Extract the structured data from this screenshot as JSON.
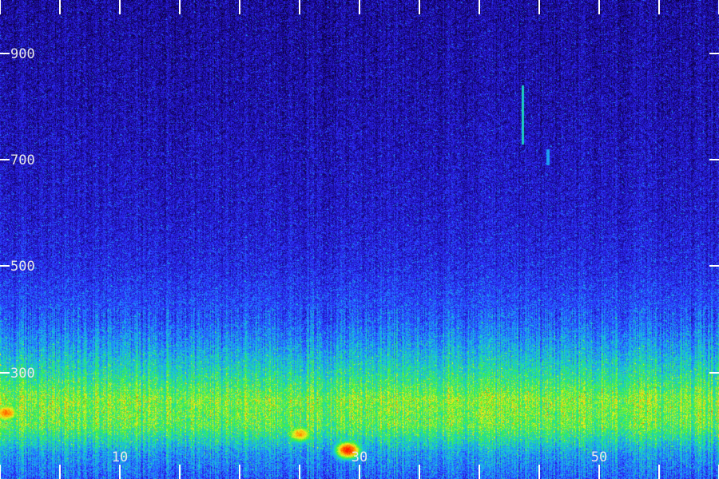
{
  "chart_data": {
    "type": "heatmap",
    "title": "",
    "xlabel": "",
    "ylabel": "",
    "colormap": [
      "#0a0028",
      "#1b0aa0",
      "#2f2cff",
      "#1e90ff",
      "#19d6c8",
      "#3cf03c",
      "#f0f020",
      "#ff8c00",
      "#ff1a00"
    ],
    "xlim": [
      0,
      60
    ],
    "ylim": [
      100,
      1000
    ],
    "y_ticks": [
      {
        "value": 300,
        "label": "300"
      },
      {
        "value": 500,
        "label": "500"
      },
      {
        "value": 700,
        "label": "700"
      },
      {
        "value": 900,
        "label": "900"
      }
    ],
    "x_ticks": [
      {
        "value": 10,
        "label": "10"
      },
      {
        "value": 30,
        "label": "30"
      },
      {
        "value": 50,
        "label": "50"
      }
    ],
    "x_minor_ticks": [
      0,
      5,
      10,
      15,
      20,
      25,
      30,
      35,
      40,
      45,
      50,
      55,
      60
    ],
    "intensity_profile": [
      {
        "freq": 1000,
        "level": 0.12
      },
      {
        "freq": 800,
        "level": 0.14
      },
      {
        "freq": 600,
        "level": 0.18
      },
      {
        "freq": 500,
        "level": 0.22
      },
      {
        "freq": 400,
        "level": 0.3
      },
      {
        "freq": 350,
        "level": 0.4
      },
      {
        "freq": 300,
        "level": 0.52
      },
      {
        "freq": 250,
        "level": 0.66
      },
      {
        "freq": 200,
        "level": 0.62
      },
      {
        "freq": 150,
        "level": 0.4
      },
      {
        "freq": 100,
        "level": 0.3
      }
    ],
    "hotspots": [
      {
        "time": 29,
        "freq": 155,
        "level": 1.0
      },
      {
        "time": 25,
        "freq": 185,
        "level": 0.85
      },
      {
        "time": 0.5,
        "freq": 225,
        "level": 0.9
      }
    ],
    "streaks": [
      {
        "time": 43.6,
        "freq_from": 730,
        "freq_to": 840,
        "level": 0.5
      },
      {
        "time": 45.7,
        "freq_from": 690,
        "freq_to": 720,
        "level": 0.4
      }
    ]
  }
}
